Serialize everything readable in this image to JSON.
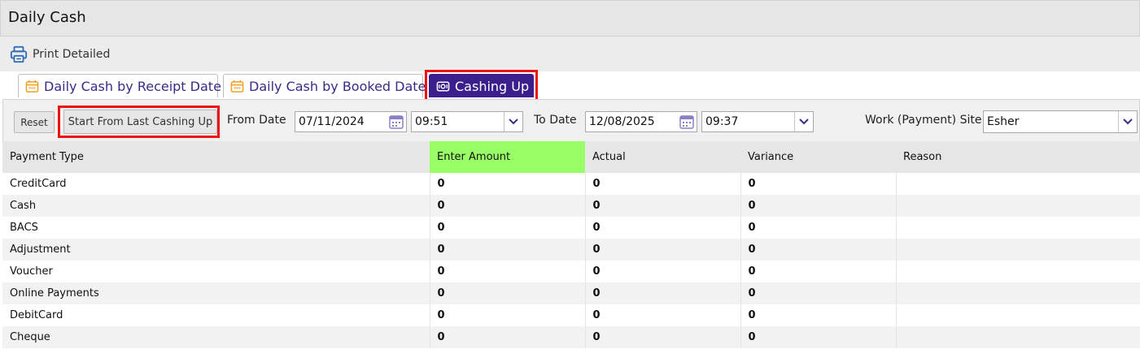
{
  "title": "Daily Cash",
  "toolbar": {
    "print_label": "Print Detailed",
    "print_icon": "printer-icon"
  },
  "tabs": [
    {
      "label": "Daily Cash by Receipt Date",
      "icon": "calendar-icon"
    },
    {
      "label": "Daily Cash by Booked Date",
      "icon": "calendar-icon"
    },
    {
      "label": "Cashing Up",
      "icon": "cash-icon",
      "active": true
    }
  ],
  "filters": {
    "reset_label": "Reset",
    "start_label": "Start From Last Cashing Up",
    "from_label": "From Date",
    "from_date": "07/11/2024",
    "from_time": "09:51",
    "to_label": "To Date",
    "to_date": "12/08/2025",
    "to_time": "09:37",
    "site_label": "Work (Payment) Site:",
    "site_value": "Esher"
  },
  "table": {
    "columns": [
      "Payment Type",
      "Enter Amount",
      "Actual",
      "Variance",
      "Reason"
    ],
    "rows": [
      [
        "CreditCard",
        "0",
        "0",
        "0",
        ""
      ],
      [
        "Cash",
        "0",
        "0",
        "0",
        ""
      ],
      [
        "BACS",
        "0",
        "0",
        "0",
        ""
      ],
      [
        "Adjustment",
        "0",
        "0",
        "0",
        ""
      ],
      [
        "Voucher",
        "0",
        "0",
        "0",
        ""
      ],
      [
        "Online Payments",
        "0",
        "0",
        "0",
        ""
      ],
      [
        "DebitCard",
        "0",
        "0",
        "0",
        ""
      ],
      [
        "Cheque",
        "0",
        "0",
        "0",
        ""
      ]
    ]
  },
  "colors": {
    "accent": "#3b1f8c",
    "tab_text": "#3b2a86",
    "highlight": "#ee1111",
    "enter_amount_header": "#99ff66",
    "calendar_icon": "#f0a020"
  }
}
